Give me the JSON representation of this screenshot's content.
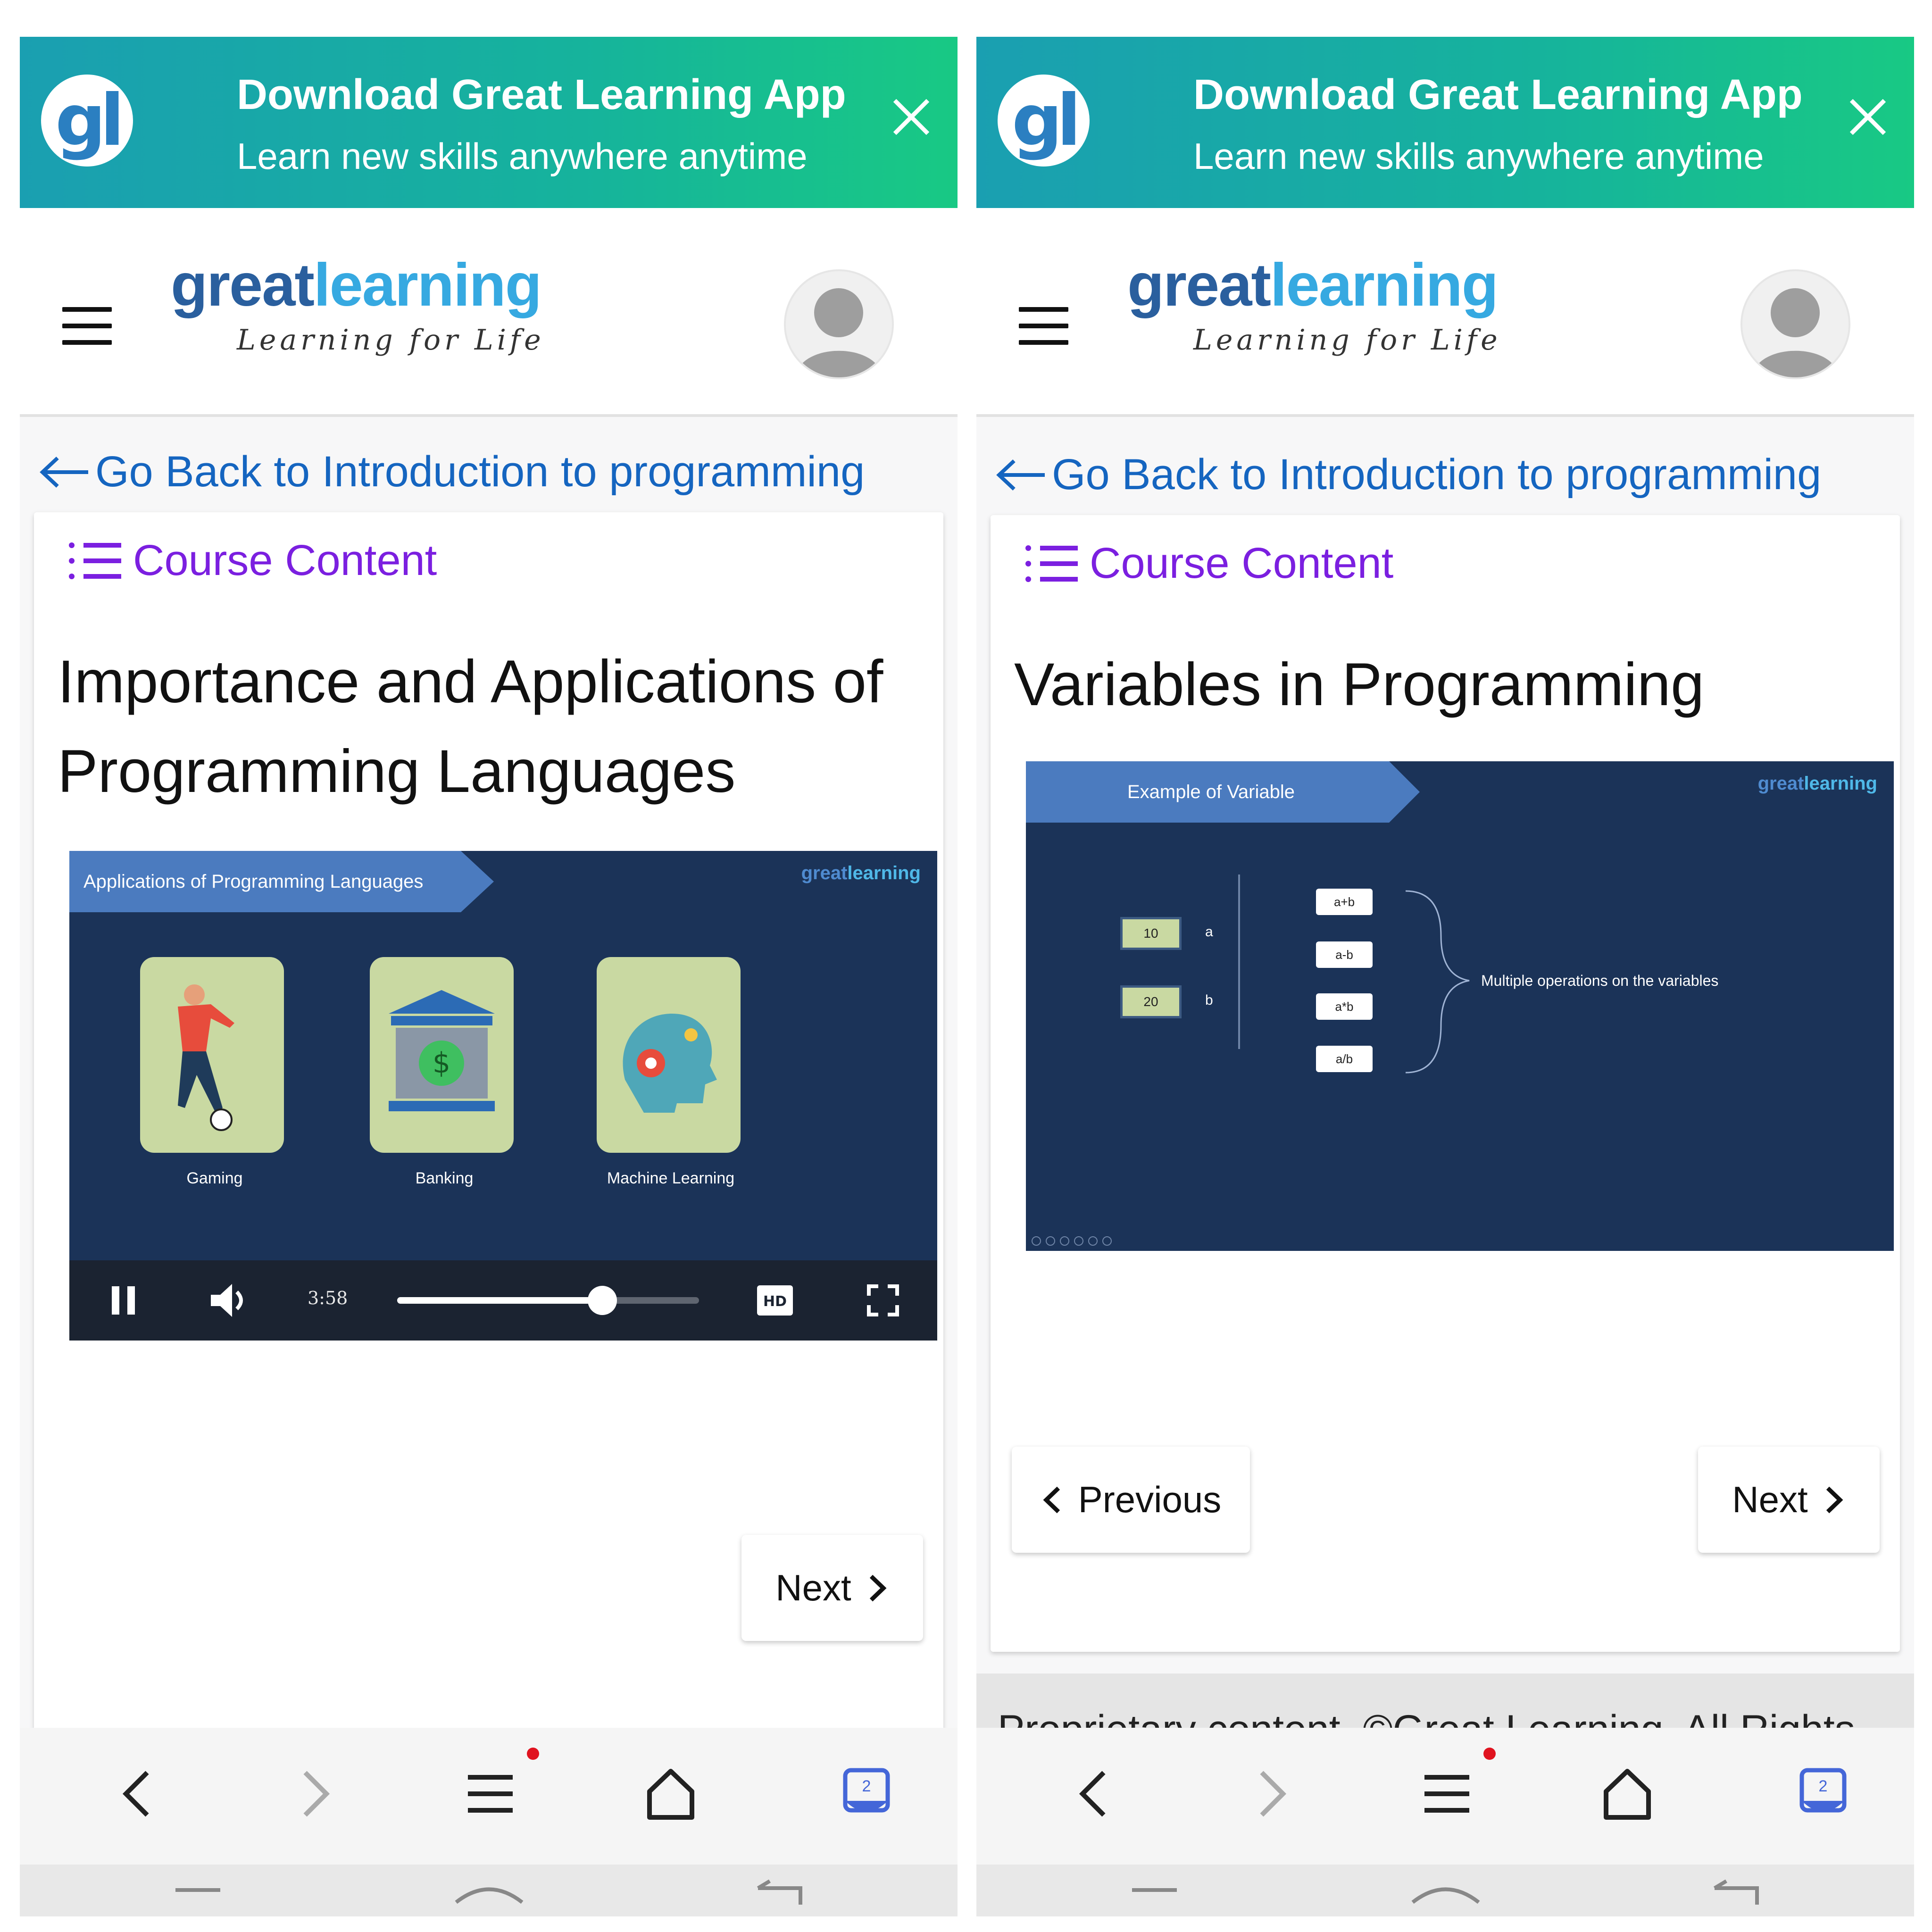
{
  "colors": {
    "banner_start": "#1a9fb1",
    "banner_end": "#18c984",
    "link": "#1565c0",
    "course_content": "#7b1fe0",
    "slide_bg": "#1b3358",
    "slide_banner": "#4b7bbf",
    "red_dot": "#e0131f"
  },
  "icons": [
    "gl-logo",
    "close-icon",
    "hamburger-icon",
    "avatar-icon",
    "arrow-left-icon",
    "list-icon",
    "pause-icon",
    "volume-icon",
    "hd-icon",
    "fullscreen-icon",
    "chevron-left-icon",
    "chevron-right-icon",
    "back-icon",
    "forward-icon",
    "menu-icon",
    "home-icon",
    "tabs-icon"
  ],
  "screens": [
    {
      "banner": {
        "logo": "gl",
        "title": "Download Great Learning App",
        "subtitle": "Learn new skills anywhere anytime"
      },
      "header": {
        "logo_great": "great",
        "logo_learning": "learning",
        "tagline": "Learning for Life"
      },
      "back_link": "Go Back to Introduction to programming",
      "course_content": "Course Content",
      "lesson_title": "Importance and Applications of Programming Languages",
      "slide": {
        "banner": "Applications of Programming Languages",
        "logo_great": "great",
        "logo_learning": "learning",
        "tiles": [
          {
            "label": "Gaming"
          },
          {
            "label": "Banking"
          },
          {
            "label": "Machine Learning"
          }
        ]
      },
      "player": {
        "time": "3:58",
        "progress": 0.68
      },
      "buttons": {
        "next": "Next"
      },
      "browser": {
        "tabs_count": "2"
      }
    },
    {
      "banner": {
        "logo": "gl",
        "title": "Download Great Learning App",
        "subtitle": "Learn new skills anywhere anytime"
      },
      "header": {
        "logo_great": "great",
        "logo_learning": "learning",
        "tagline": "Learning for Life"
      },
      "back_link": "Go Back to Introduction to programming",
      "course_content": "Course Content",
      "lesson_title": "Variables in Programming",
      "slide": {
        "banner": "Example of Variable",
        "logo_great": "great",
        "logo_learning": "learning",
        "variables": [
          {
            "value": "10",
            "name": "a"
          },
          {
            "value": "20",
            "name": "b"
          }
        ],
        "operations": [
          "a+b",
          "a-b",
          "a*b",
          "a/b"
        ],
        "operations_label": "Multiple operations on the variables"
      },
      "buttons": {
        "previous": "Previous",
        "next": "Next"
      },
      "footer": "Proprietary content. ©Great Learning. All Rights",
      "browser": {
        "tabs_count": "2"
      }
    }
  ]
}
